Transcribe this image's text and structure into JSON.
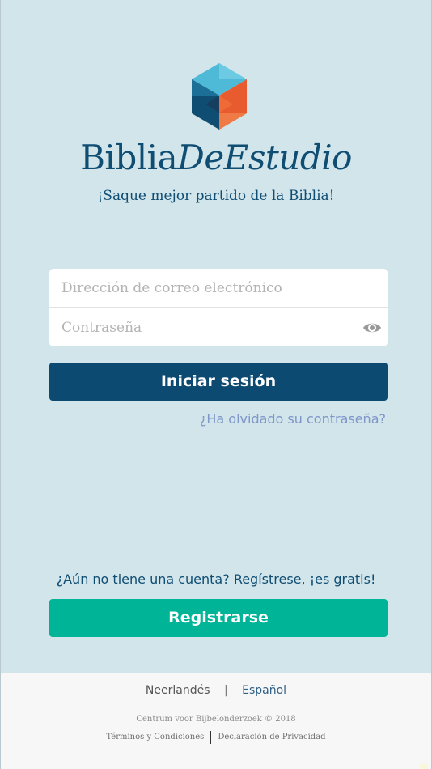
{
  "brand": {
    "name_part1": "Biblia",
    "name_part2": "DeEstudio",
    "tagline": "¡Saque mejor partido de la Biblia!",
    "logo_icon": "hexagon-cube-logo",
    "colors": {
      "light_blue": "#4fb9d8",
      "dark_blue": "#0f4d73",
      "orange": "#e85b2f",
      "light_orange": "#f07a45"
    }
  },
  "login": {
    "email_placeholder": "Dirección de correo electrónico",
    "password_placeholder": "Contraseña",
    "show_password_icon": "eye-icon",
    "login_button": "Iniciar sesión",
    "forgot_link": "¿Ha olvidado su contraseña?"
  },
  "signup": {
    "prompt": "¿Aún no tiene una cuenta? Regístrese, ¡es gratis!",
    "register_button": "Registrarse"
  },
  "footer": {
    "languages": [
      {
        "label": "Neerlandés",
        "active": false
      },
      {
        "label": "Español",
        "active": true
      }
    ],
    "language_separator": "|",
    "copyright": "Centrum voor Bijbelonderzoek © 2018",
    "terms_link": "Términos y Condiciones",
    "privacy_link": "Declaración de Privacidad"
  },
  "colors": {
    "background": "#d1e5ea",
    "primary_button": "#0d4a72",
    "register_button": "#00b597",
    "forgot_link": "#7f97c9",
    "footer_background": "#f7f7f7"
  }
}
